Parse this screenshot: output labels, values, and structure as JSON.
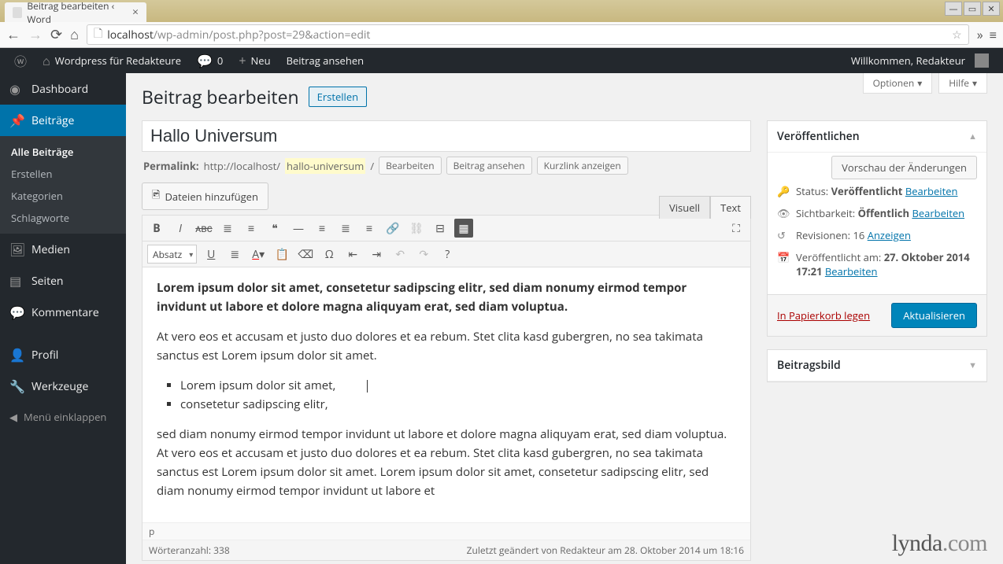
{
  "browser": {
    "tab_title": "Beitrag bearbeiten ‹ Word",
    "url_host": "localhost",
    "url_path": "/wp-admin/post.php?post=29&action=edit"
  },
  "adminbar": {
    "site_name": "Wordpress für Redakteure",
    "comments_count": "0",
    "new_label": "Neu",
    "view_post": "Beitrag ansehen",
    "welcome": "Willkommen, Redakteur"
  },
  "menu": {
    "dashboard": "Dashboard",
    "posts": "Beiträge",
    "posts_sub": {
      "all": "Alle Beiträge",
      "new": "Erstellen",
      "categories": "Kategorien",
      "tags": "Schlagworte"
    },
    "media": "Medien",
    "pages": "Seiten",
    "comments": "Kommentare",
    "profile": "Profil",
    "tools": "Werkzeuge",
    "collapse": "Menü einklappen"
  },
  "screen_meta": {
    "options": "Optionen",
    "help": "Hilfe"
  },
  "heading": {
    "title": "Beitrag bearbeiten",
    "add_new": "Erstellen"
  },
  "post": {
    "title": "Hallo Universum",
    "permalink_label": "Permalink:",
    "permalink_base": "http://localhost/",
    "permalink_slug": "hallo-universum",
    "permalink_slash": "/",
    "edit_btn": "Bearbeiten",
    "view_btn": "Beitrag ansehen",
    "shortlink_btn": "Kurzlink anzeigen",
    "add_media": "Dateien hinzufügen",
    "tab_visual": "Visuell",
    "tab_text": "Text",
    "format_select": "Absatz",
    "content_bold": "Lorem ipsum dolor sit amet, consetetur sadipscing elitr, sed diam nonumy eirmod tempor invidunt ut labore et dolore magna aliquyam erat, sed diam voluptua.",
    "content_p2": "At vero eos et accusam et justo duo dolores et ea rebum. Stet clita kasd gubergren, no sea takimata sanctus est Lorem ipsum dolor sit amet.",
    "content_li1": "Lorem ipsum dolor sit amet,",
    "content_li2": "consetetur sadipscing elitr,",
    "content_p3": "sed diam nonumy eirmod tempor invidunt ut labore et dolore magna aliquyam erat, sed diam voluptua. At vero eos et accusam et justo duo dolores et ea rebum. Stet clita kasd gubergren, no sea takimata sanctus est Lorem ipsum dolor sit amet. Lorem ipsum dolor sit amet, consetetur sadipscing elitr, sed diam nonumy eirmod tempor invidunt ut labore et",
    "statusbar": "p",
    "word_count_label": "Wörteranzahl: 338",
    "last_edited": "Zuletzt geändert von Redakteur am 28. Oktober 2014 um 18:16"
  },
  "publish": {
    "box_title": "Veröffentlichen",
    "preview_btn": "Vorschau der Änderungen",
    "status_label": "Status:",
    "status_value": "Veröffentlicht",
    "visibility_label": "Sichtbarkeit:",
    "visibility_value": "Öffentlich",
    "revisions_label": "Revisionen:",
    "revisions_count": "16",
    "revisions_link": "Anzeigen",
    "published_label": "Veröffentlicht am:",
    "published_value": "27. Oktober 2014 17:21",
    "edit_link": "Bearbeiten",
    "trash": "In Papierkorb legen",
    "update": "Aktualisieren"
  },
  "featured": {
    "box_title": "Beitragsbild"
  },
  "watermark": {
    "brand": "lynda",
    "suffix": ".com"
  }
}
